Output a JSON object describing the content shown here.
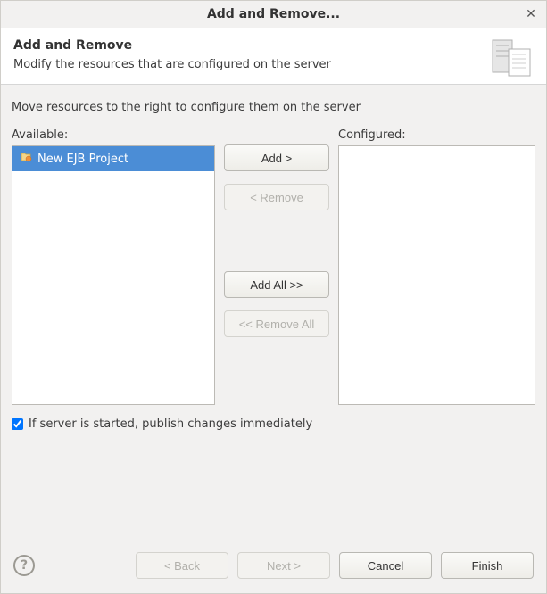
{
  "window": {
    "title": "Add and Remove..."
  },
  "banner": {
    "heading": "Add and Remove",
    "subtitle": "Modify the resources that are configured on the server"
  },
  "instruction": "Move resources to the right to configure them on the server",
  "available": {
    "label": "Available:",
    "items": [
      {
        "label": "New EJB Project"
      }
    ]
  },
  "configured": {
    "label": "Configured:",
    "items": []
  },
  "buttons": {
    "add": "Add >",
    "remove": "< Remove",
    "addAll": "Add All >>",
    "removeAll": "<< Remove All"
  },
  "checkbox": {
    "label": "If server is started, publish changes immediately",
    "checked": true
  },
  "footer": {
    "back": "< Back",
    "next": "Next >",
    "cancel": "Cancel",
    "finish": "Finish"
  }
}
